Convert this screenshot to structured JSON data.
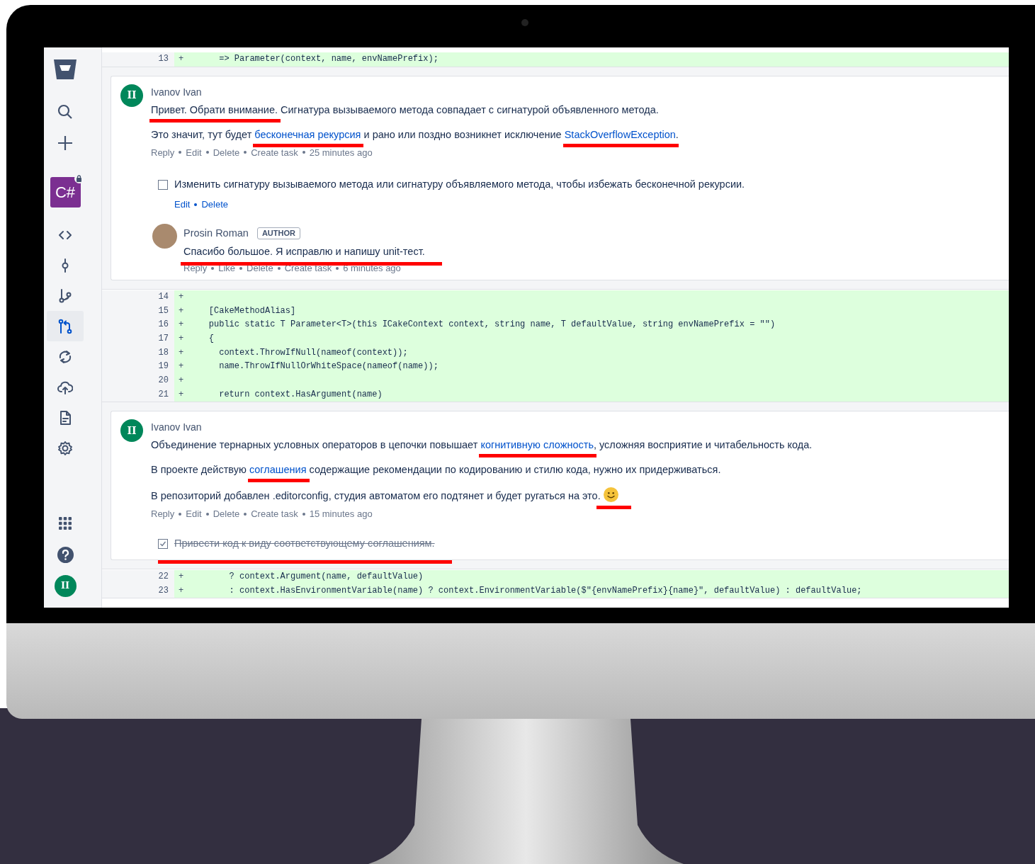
{
  "sidebar": {
    "repo_tile": {
      "label": "C#",
      "locked": true
    },
    "nav_items": [
      {
        "kind": "source",
        "selected": false
      },
      {
        "kind": "commits",
        "selected": false
      },
      {
        "kind": "branches",
        "selected": false
      },
      {
        "kind": "pull-requests",
        "selected": true
      },
      {
        "kind": "pipelines",
        "selected": false
      },
      {
        "kind": "deployments",
        "selected": false
      },
      {
        "kind": "reports",
        "selected": false
      },
      {
        "kind": "settings",
        "selected": false
      }
    ],
    "user_avatar": "II"
  },
  "diff": [
    {
      "code_lines": [
        {
          "number": "13",
          "sign": "+",
          "code": "      => Parameter(context, name, envNamePrefix);"
        }
      ]
    },
    {
      "comment": {
        "author": "Ivanov Ivan",
        "avatar": {
          "kind": "initials",
          "text": "II"
        },
        "paragraphs": [
          [
            {
              "text": "Привет. Обрати внимание.",
              "link": false,
              "marked": true
            },
            {
              "text": " Сигнатура вызываемого метода совпадает с сигнатурой объявленного метода.",
              "link": false
            }
          ],
          [
            {
              "text": "Это значит, тут будет ",
              "link": false
            },
            {
              "text": "бесконечная рекурсия",
              "link": true,
              "marked": true
            },
            {
              "text": " и рано или поздно возникнет исключение ",
              "link": false
            },
            {
              "text": "StackOverflowException",
              "link": true,
              "marked": true
            },
            {
              "text": ".",
              "link": false
            }
          ]
        ],
        "actions": [
          "Reply",
          "Edit",
          "Delete",
          "Create task"
        ],
        "time": "25 minutes ago",
        "tasks": [
          {
            "text": "Изменить сигнатуру вызываемого метода или сигнатуру объявляемого метода, чтобы избежать бесконечной рекурсии.",
            "checked": false,
            "actions": [
              "Edit",
              "Delete"
            ]
          }
        ],
        "replies": [
          {
            "author": "Prosin Roman",
            "badge": "AUTHOR",
            "avatar": {
              "kind": "photo"
            },
            "text": "Спасибо большое. Я исправлю и напишу unit-тест.",
            "marked": true,
            "actions": [
              "Reply",
              "Like",
              "Delete",
              "Create task"
            ],
            "time": "6 minutes ago"
          }
        ]
      }
    },
    {
      "code_lines": [
        {
          "number": "14",
          "sign": "+"
        },
        {
          "number": "15",
          "sign": "+",
          "code": "    [CakeMethodAlias]"
        },
        {
          "number": "16",
          "sign": "+",
          "code": "    public static T Parameter<T>(this ICakeContext context, string name, T defaultValue, string envNamePrefix = \"\")"
        },
        {
          "number": "17",
          "sign": "+",
          "code": "    {"
        },
        {
          "number": "18",
          "sign": "+",
          "code": "      context.ThrowIfNull(nameof(context));"
        },
        {
          "number": "19",
          "sign": "+",
          "code": "      name.ThrowIfNullOrWhiteSpace(nameof(name));"
        },
        {
          "number": "20",
          "sign": "+"
        },
        {
          "number": "21",
          "sign": "+",
          "code": "      return context.HasArgument(name)"
        }
      ]
    },
    {
      "comment": {
        "author": "Ivanov Ivan",
        "avatar": {
          "kind": "initials",
          "text": "II"
        },
        "paragraphs": [
          [
            {
              "text": "Объединение тернарных условных операторов в цепочки повышает ",
              "link": false
            },
            {
              "text": "когнитивную сложность",
              "link": true,
              "marked": true
            },
            {
              "text": ", усложняя восприятие и читабельность кода.",
              "link": false
            }
          ],
          [
            {
              "text": "В проекте действую ",
              "link": false
            },
            {
              "text": "соглашения",
              "link": true,
              "marked": true
            },
            {
              "text": " содержащие рекомендации по кодированию и стилю кода, нужно их придерживаться.",
              "link": false
            }
          ],
          [
            {
              "text": "В репозиторий добавлен .editorconfig, студия автоматом его подтянет и будет ругаться на это. ",
              "link": false
            },
            {
              "kind": "emoji",
              "marked": true
            }
          ]
        ],
        "actions": [
          "Reply",
          "Edit",
          "Delete",
          "Create task"
        ],
        "time": "15 minutes ago",
        "tasks": [
          {
            "text": "Привести код к виду соответствующему соглашениям.",
            "checked": true,
            "marked": true
          }
        ]
      }
    },
    {
      "code_lines": [
        {
          "number": "22",
          "sign": "+",
          "code": "        ? context.Argument(name, defaultValue)"
        },
        {
          "number": "23",
          "sign": "+",
          "code": "        : context.HasEnvironmentVariable(name) ? context.EnvironmentVariable($\"{envNamePrefix}{name}\", defaultValue) : defaultValue;"
        }
      ]
    }
  ]
}
